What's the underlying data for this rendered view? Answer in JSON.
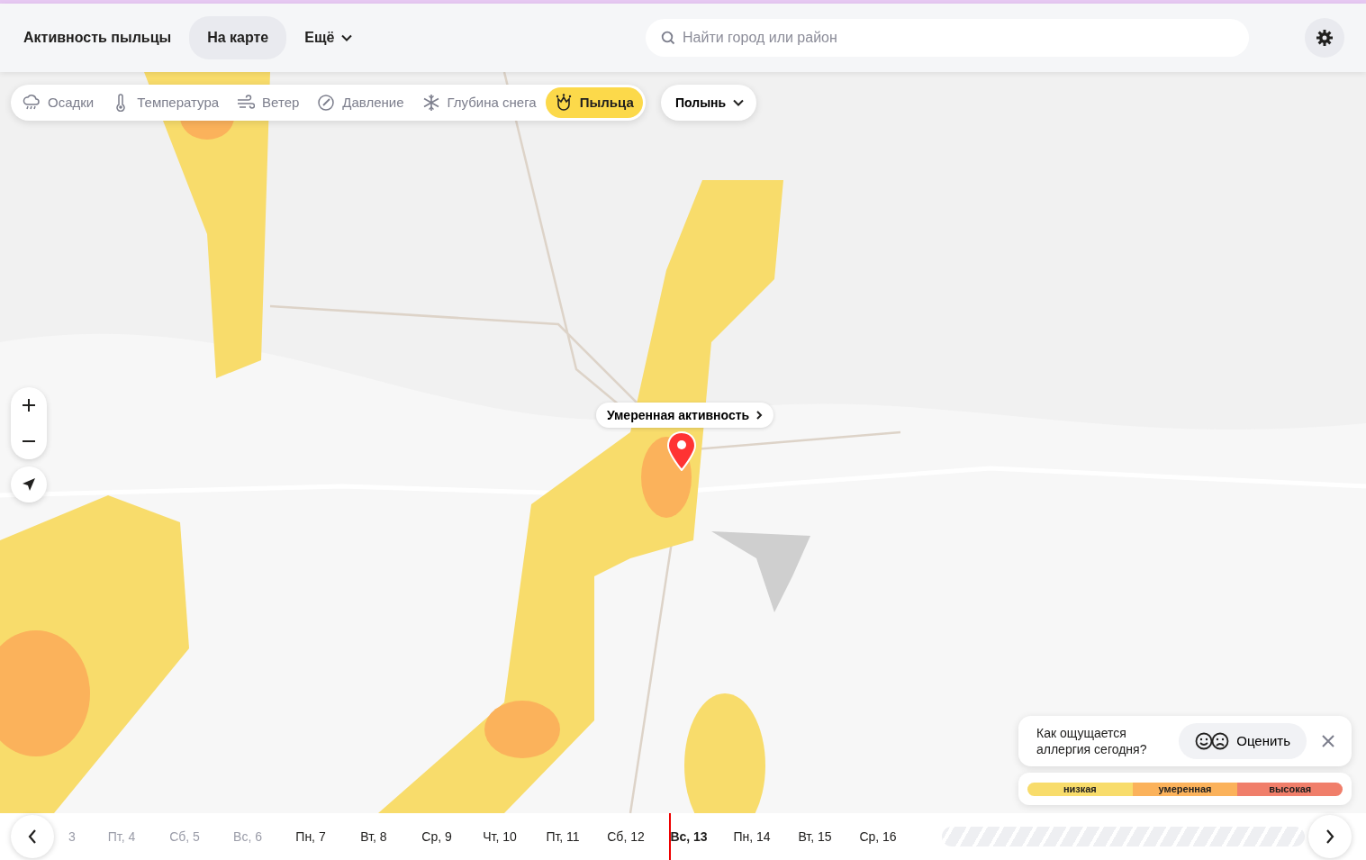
{
  "header": {
    "title": "Активность пыльцы",
    "nav": [
      {
        "label": "На карте",
        "selected": true,
        "kind": "link"
      },
      {
        "label": "Ещё",
        "selected": false,
        "kind": "dropdown"
      }
    ],
    "search": {
      "placeholder": "Найти город или район"
    }
  },
  "layers": [
    {
      "label": "Осадки",
      "kind": "rain",
      "selected": false
    },
    {
      "label": "Температура",
      "kind": "thermometer",
      "selected": false
    },
    {
      "label": "Ветер",
      "kind": "wind",
      "selected": false
    },
    {
      "label": "Давление",
      "kind": "gauge",
      "selected": false
    },
    {
      "label": "Глубина снега",
      "kind": "snow",
      "selected": false
    },
    {
      "label": "Пыльца",
      "kind": "flower",
      "selected": true
    }
  ],
  "plant_select": {
    "value": "Полынь"
  },
  "map": {
    "popup": "Умеренная активность"
  },
  "feedback": {
    "question": "Как ощущается аллергия сегодня?",
    "button": "Оценить"
  },
  "legend": [
    {
      "label": "низкая",
      "color": "#f8dc6b"
    },
    {
      "label": "умеренная",
      "color": "#fbb25b"
    },
    {
      "label": "высокая",
      "color": "#f07e6a"
    }
  ],
  "timeline": {
    "days": [
      {
        "label": "3",
        "past": true,
        "selected": false
      },
      {
        "label": "Пт, 4",
        "past": true,
        "selected": false
      },
      {
        "label": "Сб, 5",
        "past": true,
        "selected": false
      },
      {
        "label": "Вс, 6",
        "past": true,
        "selected": false
      },
      {
        "label": "Пн, 7",
        "past": false,
        "selected": false
      },
      {
        "label": "Вт, 8",
        "past": false,
        "selected": false
      },
      {
        "label": "Ср, 9",
        "past": false,
        "selected": false
      },
      {
        "label": "Чт, 10",
        "past": false,
        "selected": false
      },
      {
        "label": "Пт, 11",
        "past": false,
        "selected": false
      },
      {
        "label": "Сб, 12",
        "past": false,
        "selected": false
      },
      {
        "label": "Вс, 13",
        "past": false,
        "selected": true
      },
      {
        "label": "Пн, 14",
        "past": false,
        "selected": false
      },
      {
        "label": "Вт, 15",
        "past": false,
        "selected": false
      },
      {
        "label": "Ср, 16",
        "past": false,
        "selected": false
      }
    ]
  }
}
